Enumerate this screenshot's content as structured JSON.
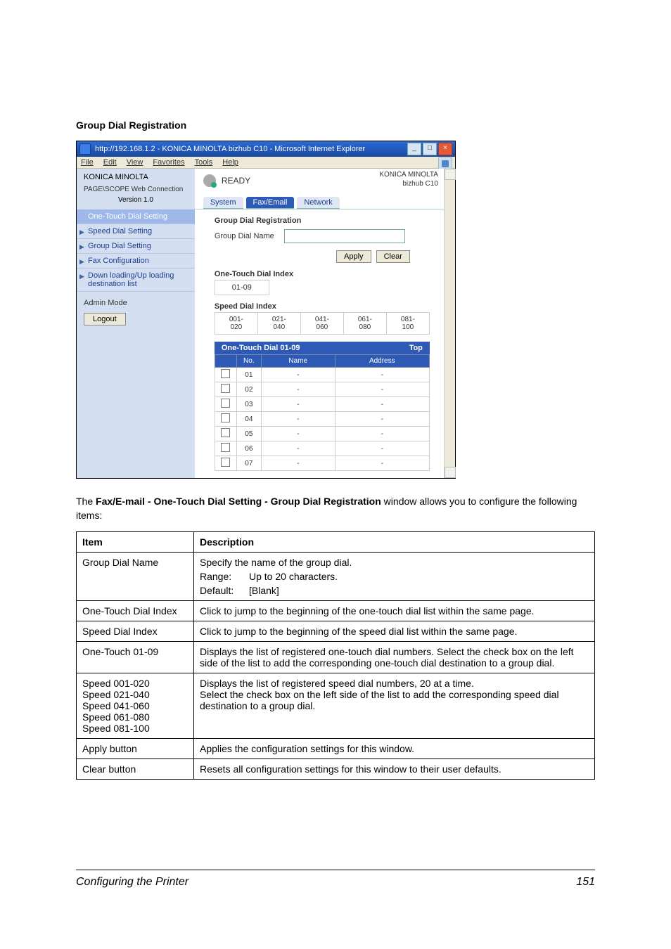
{
  "heading": "Group Dial Registration",
  "browser": {
    "window_title": "http://192.168.1.2 - KONICA MINOLTA bizhub C10 - Microsoft Internet Explorer",
    "menu_items": [
      "File",
      "Edit",
      "View",
      "Favorites",
      "Tools",
      "Help"
    ],
    "brand": "KONICA MINOLTA",
    "subbrand": "PAGE\\SCOPE Web Connection",
    "version": "Version 1.0",
    "status_text": "READY",
    "product_right1": "KONICA MINOLTA",
    "product_right2": "bizhub C10",
    "tabs": {
      "system": "System",
      "fax": "Fax/Email",
      "network": "Network"
    },
    "nav": {
      "one_touch": "One-Touch Dial Setting",
      "speed_dial": "Speed Dial Setting",
      "group_dial": "Group Dial Setting",
      "fax_conf": "Fax Configuration",
      "downup": "Down loading/Up loading destination list"
    },
    "admin_mode": "Admin Mode",
    "logout": "Logout",
    "form": {
      "header": "Group Dial Registration",
      "name_label": "Group Dial Name",
      "apply": "Apply",
      "clear": "Clear",
      "ot_index_label": "One-Touch Dial Index",
      "ot_index_value": "01-09",
      "speed_index_label": "Speed Dial Index",
      "speed_ranges": [
        "001-020",
        "021-040",
        "041-060",
        "061-080",
        "081-100"
      ],
      "ot_bar_label": "One-Touch Dial 01-09",
      "top": "Top",
      "col_no": "No.",
      "col_name": "Name",
      "col_addr": "Address",
      "rows": [
        "01",
        "02",
        "03",
        "04",
        "05",
        "06",
        "07"
      ]
    }
  },
  "paragraph_prefix": "The ",
  "paragraph_bold": "Fax/E-mail - One-Touch Dial Setting - Group Dial Registration",
  "paragraph_suffix": " window allows you to configure the following items:",
  "table": {
    "hdr_item": "Item",
    "hdr_desc": "Description",
    "rows": [
      {
        "item": "Group Dial Name",
        "desc_line1": "Specify the name of the group dial.",
        "range_label": "Range:",
        "range_val": "Up to 20 characters.",
        "default_label": "Default:",
        "default_val": "[Blank]"
      },
      {
        "item": "One-Touch Dial Index",
        "desc": "Click to jump to the beginning of the one-touch dial list within the same page."
      },
      {
        "item": "Speed Dial Index",
        "desc": "Click to jump to the beginning of the speed dial list within the same page."
      },
      {
        "item": "One-Touch 01-09",
        "desc": "Displays the list of registered one-touch dial numbers. Select the check box on the left side of the list to add the corresponding one-touch dial destination to a group dial."
      },
      {
        "item_lines": [
          "Speed 001-020",
          "Speed 021-040",
          "Speed 041-060",
          "Speed 061-080",
          "Speed 081-100"
        ],
        "desc": "Displays the list of registered speed dial numbers, 20 at a time.\nSelect the check box on the left side of the list to add the corresponding speed dial destination to a group dial."
      },
      {
        "item": "Apply button",
        "desc": "Applies the configuration settings for this window."
      },
      {
        "item": "Clear button",
        "desc": "Resets all configuration settings for this window to their user defaults."
      }
    ]
  },
  "footer": {
    "left": "Configuring the Printer",
    "right": "151"
  }
}
